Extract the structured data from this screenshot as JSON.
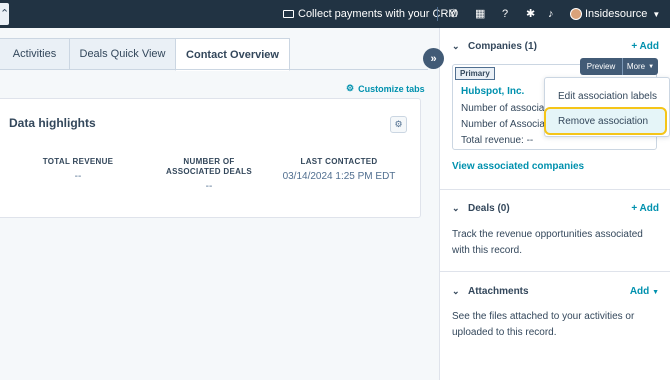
{
  "topnav": {
    "left_partial": "⌃",
    "payments_label": "Collect payments with your CRM",
    "account_name": "Insidesource"
  },
  "tabs": [
    {
      "label": "Activities"
    },
    {
      "label": "Deals Quick View"
    },
    {
      "label": "Contact Overview"
    }
  ],
  "customize_tabs_label": "Customize tabs",
  "data_highlights": {
    "title": "Data highlights",
    "metrics": [
      {
        "label": "TOTAL REVENUE",
        "value": "--"
      },
      {
        "label": "NUMBER OF ASSOCIATED DEALS",
        "value": "--"
      },
      {
        "label": "LAST CONTACTED",
        "value": "03/14/2024 1:25 PM EDT"
      }
    ]
  },
  "sidebar": {
    "companies": {
      "title": "Companies (1)",
      "add_label": "+ Add",
      "primary_badge": "Primary",
      "company_name": "Hubspot, Inc.",
      "row1": "Number of associate",
      "row2": "Number of Associat",
      "row3": "Total revenue:  --",
      "preview_label": "Preview",
      "more_label": "More",
      "view_all_label": "View associated companies"
    },
    "deals": {
      "title": "Deals (0)",
      "add_label": "+ Add",
      "description": "Track the revenue opportunities associated with this record."
    },
    "attachments": {
      "title": "Attachments",
      "add_label": "Add",
      "description": "See the files attached to your activities or uploaded to this record."
    }
  },
  "more_menu": {
    "items": [
      {
        "label": "Edit association labels"
      },
      {
        "label": "Remove association"
      }
    ]
  },
  "colors": {
    "nav_bg": "#213343",
    "link": "#0091ae",
    "button_dark": "#425b76",
    "highlight_outline": "#f5c518"
  }
}
